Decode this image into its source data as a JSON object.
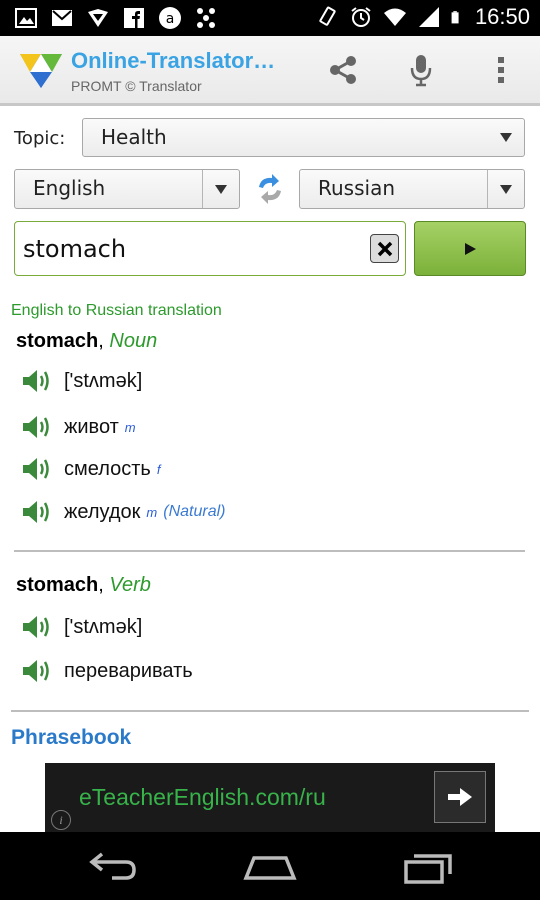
{
  "status_bar": {
    "time": "16:50",
    "left_icons": [
      "gallery-icon",
      "gmail-icon",
      "vpn-icon",
      "facebook-icon",
      "app-a-icon",
      "pinwheel-icon"
    ],
    "right_icons": [
      "rotation-icon",
      "alarm-icon",
      "wifi-icon",
      "signal-icon",
      "battery-icon"
    ]
  },
  "action_bar": {
    "title": "Online-Translator…",
    "subtitle": "PROMT © Translator",
    "actions": [
      "share-icon",
      "microphone-icon",
      "overflow-menu-icon"
    ]
  },
  "form": {
    "topic_label": "Topic:",
    "topic_value": "Health",
    "source_language": "English",
    "target_language": "Russian",
    "search_value": "stomach"
  },
  "results": {
    "caption": "English to Russian translation",
    "entries": [
      {
        "word": "stomach",
        "separator": ", ",
        "pos": "Noun",
        "rows": [
          {
            "text": "['stʌmək]",
            "gender": "",
            "note": ""
          },
          {
            "text": "живот",
            "gender": "m",
            "note": ""
          },
          {
            "text": "смелость",
            "gender": "f",
            "note": ""
          },
          {
            "text": "желудок",
            "gender": "m",
            "note": "(Natural)"
          }
        ]
      },
      {
        "word": "stomach",
        "separator": ", ",
        "pos": "Verb",
        "rows": [
          {
            "text": "['stʌmək]",
            "gender": "",
            "note": ""
          },
          {
            "text": "переваривать",
            "gender": "",
            "note": ""
          }
        ]
      }
    ],
    "phrasebook_label": "Phrasebook"
  },
  "ad": {
    "text": "eTeacherEnglish.com/ru",
    "info": "i"
  },
  "colors": {
    "accent_blue": "#3aa3e3",
    "accent_green": "#2c9a2c",
    "button_green": "#7bb13a",
    "gender_blue": "#2a5bd7"
  }
}
